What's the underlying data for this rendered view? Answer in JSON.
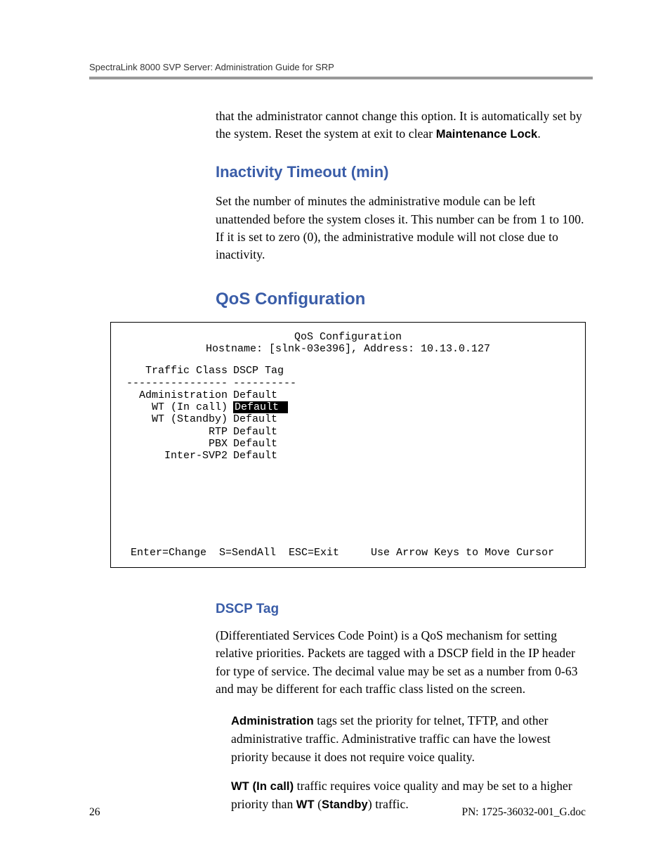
{
  "header": {
    "title": "SpectraLink 8000 SVP Server: Administration Guide for SRP"
  },
  "para1": {
    "part1": "that the administrator cannot change this option. It is automatically set by the system. Reset the system at exit to clear ",
    "bold1": "Maintenance Lock",
    "part2": "."
  },
  "section1": {
    "heading": "Inactivity Timeout (min)",
    "body": "Set the number of minutes the administrative module can be left unattended before the system closes it. This number can be from 1 to 100. If it is set to zero (0), the administrative module will not close due to inactivity."
  },
  "section2": {
    "heading": "QoS Configuration"
  },
  "terminal": {
    "title": "QoS Configuration",
    "hostline": "Hostname: [slnk-03e396], Address: 10.13.0.127",
    "header_left": "Traffic Class",
    "header_right": "DSCP Tag",
    "divider_left": "----------------",
    "divider_right": "----------",
    "rows": [
      {
        "label": "Administration",
        "value": "Default",
        "highlight": false
      },
      {
        "label": "WT (In call)",
        "value": "Default",
        "highlight": true
      },
      {
        "label": "WT (Standby)",
        "value": "Default",
        "highlight": false
      },
      {
        "label": "RTP",
        "value": "Default",
        "highlight": false
      },
      {
        "label": "PBX",
        "value": "Default",
        "highlight": false
      },
      {
        "label": "Inter-SVP2",
        "value": "Default",
        "highlight": false
      }
    ],
    "footer": "Enter=Change  S=SendAll  ESC=Exit     Use Arrow Keys to Move Cursor"
  },
  "section3": {
    "heading": "DSCP Tag",
    "body": "(Differentiated Services Code Point) is a QoS mechanism for setting relative priorities. Packets are tagged with a DSCP field in the IP header for type of service. The decimal value may be set as a number from 0-63 and may be different for each traffic class listed on the screen."
  },
  "indent1": {
    "bold": "Administration",
    "rest": " tags set the priority for telnet, TFTP, and other administrative traffic. Administrative traffic can have the lowest priority because it does not require voice quality."
  },
  "indent2": {
    "bold1": "WT (In call)",
    "mid1": " traffic requires voice quality and may be set to a higher priority than ",
    "bold2": "WT",
    "mid2": " (",
    "bold3": "Standby",
    "end": ") traffic."
  },
  "footer": {
    "pageno": "26",
    "docid": "PN: 1725-36032-001_G.doc"
  }
}
